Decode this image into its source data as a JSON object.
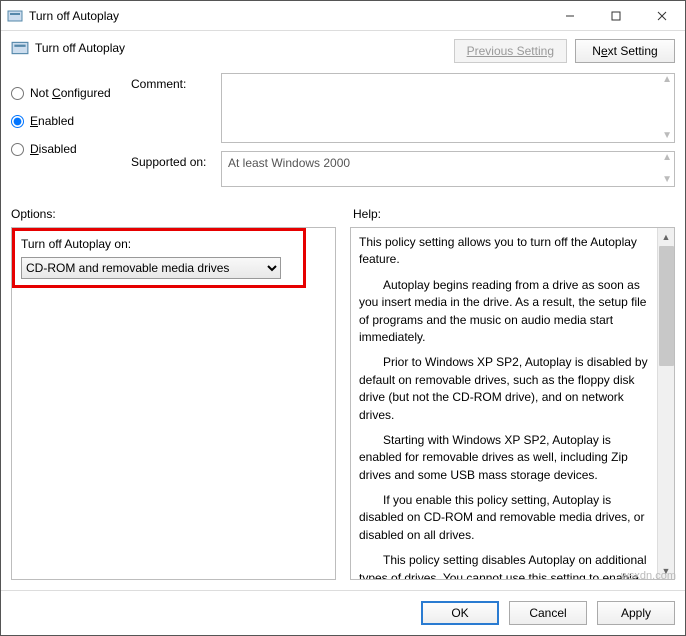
{
  "window": {
    "title": "Turn off Autoplay"
  },
  "header": {
    "title": "Turn off Autoplay",
    "prev": "Previous Setting",
    "next_pre": "N",
    "next_u": "e",
    "next_post": "xt Setting"
  },
  "radios": {
    "not_configured": "Not Configured",
    "enabled_pre": "",
    "enabled_u": "E",
    "enabled_post": "nabled",
    "disabled_pre": "",
    "disabled_u": "D",
    "disabled_post": "isabled",
    "notconf_pre": "Not ",
    "notconf_u": "C",
    "notconf_post": "onfigured"
  },
  "labels": {
    "comment": "Comment:",
    "supported": "Supported on:",
    "options": "Options:",
    "help": "Help:"
  },
  "supported_text": "At least Windows 2000",
  "options": {
    "label": "Turn off Autoplay on:",
    "selected": "CD-ROM and removable media drives"
  },
  "help": {
    "p1": "This policy setting allows you to turn off the Autoplay feature.",
    "p2": "Autoplay begins reading from a drive as soon as you insert media in the drive. As a result, the setup file of programs and the music on audio media start immediately.",
    "p3": "Prior to Windows XP SP2, Autoplay is disabled by default on removable drives, such as the floppy disk drive (but not the CD-ROM drive), and on network drives.",
    "p4": "Starting with Windows XP SP2, Autoplay is enabled for removable drives as well, including Zip drives and some USB mass storage devices.",
    "p5": "If you enable this policy setting, Autoplay is disabled on CD-ROM and removable media drives, or disabled on all drives.",
    "p6": "This policy setting disables Autoplay on additional types of drives. You cannot use this setting to enable Autoplay on drives on which it is disabled by default."
  },
  "footer": {
    "ok": "OK",
    "cancel": "Cancel",
    "apply": "Apply"
  },
  "watermark": "wsxdn.com"
}
